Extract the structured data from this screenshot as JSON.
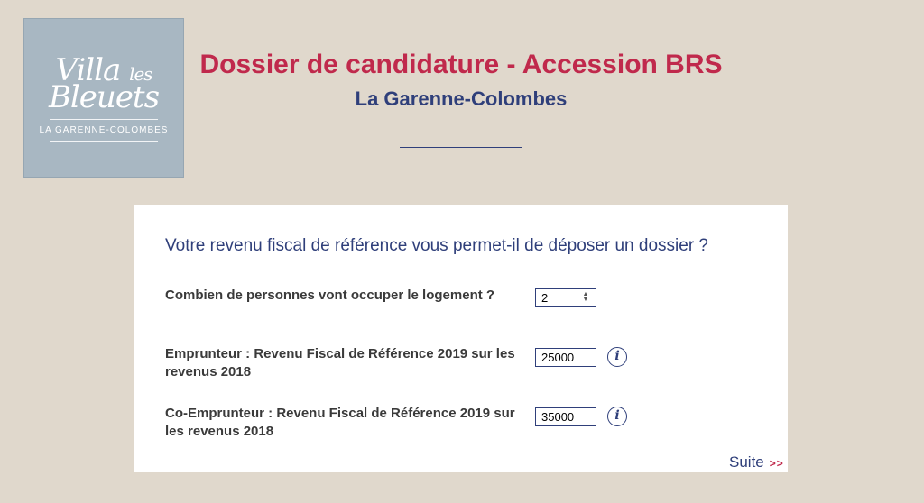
{
  "logo": {
    "line1_main": "Villa",
    "line1_small": "les",
    "line2": "Bleuets",
    "tagline": "LA GARENNE-COLOMBES"
  },
  "header": {
    "title": "Dossier de candidature - Accession BRS",
    "subtitle": "La Garenne-Colombes"
  },
  "form": {
    "question": "Votre revenu fiscal de référence vous permet-il de déposer un dossier ?",
    "persons": {
      "label": "Combien de personnes vont occuper le logement ?",
      "value": "2"
    },
    "borrower": {
      "label": "Emprunteur : Revenu Fiscal de Référence 2019 sur les revenus 2018",
      "value": "25000",
      "info_icon": "i"
    },
    "co_borrower": {
      "label": "Co-Emprunteur : Revenu Fiscal de Référence 2019 sur les revenus 2018",
      "value": "35000",
      "info_icon": "i"
    }
  },
  "footer": {
    "next_label": "Suite",
    "next_arrows": ">>"
  },
  "colors": {
    "background": "#e0d8cc",
    "title": "#c0294c",
    "navy": "#2f3f7a",
    "logo_bg": "#a8b7c2"
  }
}
